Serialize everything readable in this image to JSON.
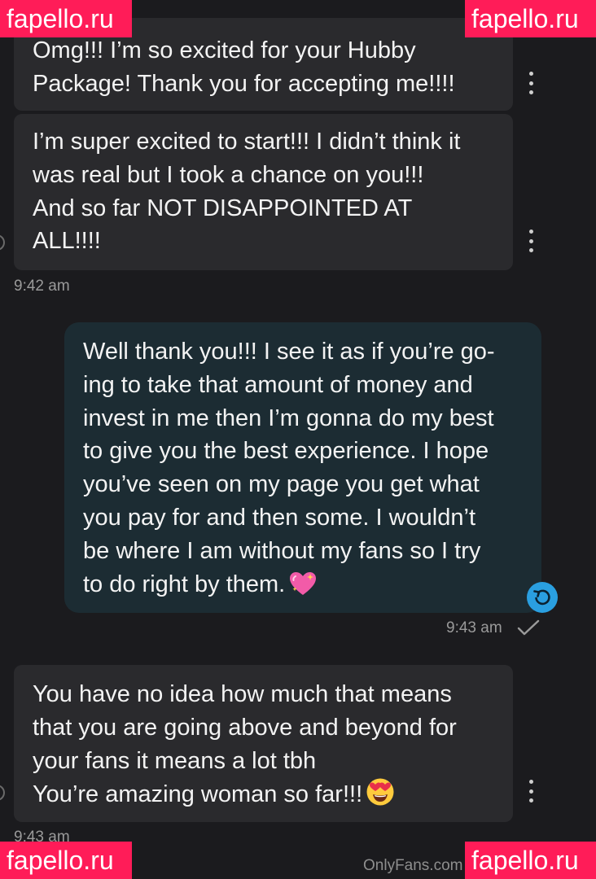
{
  "messages": [
    {
      "text": "Omg!!! I’m so excited for your Hubby\nPackage! Thank you for accepting me!!!!",
      "direction": "incoming"
    },
    {
      "text": "I’m super excited to start!!! I didn’t think it\nwas real but I took a chance on you!!!\nAnd so far NOT DISAPPOINTED AT\nALL!!!!",
      "direction": "incoming",
      "time": "9:42 am"
    },
    {
      "text": "Well thank you!!! I see it as if you’re go-\ning to take that amount of money and\ninvest in me then I’m gonna do my best\nto give you the best experience. I hope\nyou’ve seen on my page you get what\nyou pay for and then some. I wouldn’t\nbe where I am without my fans so I try\nto do right by them.",
      "direction": "outgoing",
      "time": "9:43 am",
      "emoji": "sparkling-heart",
      "status": "sent-check"
    },
    {
      "text": "You have no idea how much that means\nthat you are going above and beyond for\nyour fans it means a lot tbh\nYou’re amazing woman so far!!!",
      "direction": "incoming",
      "time": "9:43 am",
      "emoji": "heart-eyes-face"
    }
  ],
  "watermark": "fapello.ru",
  "footer_credit": "OnlyFans.com",
  "colors": {
    "background": "#1b1b1e",
    "incoming_bubble": "#2a2a2d",
    "outgoing_bubble": "#1c2c33",
    "accent_blue": "#2a9fe0",
    "watermark": "#ff1c58"
  }
}
